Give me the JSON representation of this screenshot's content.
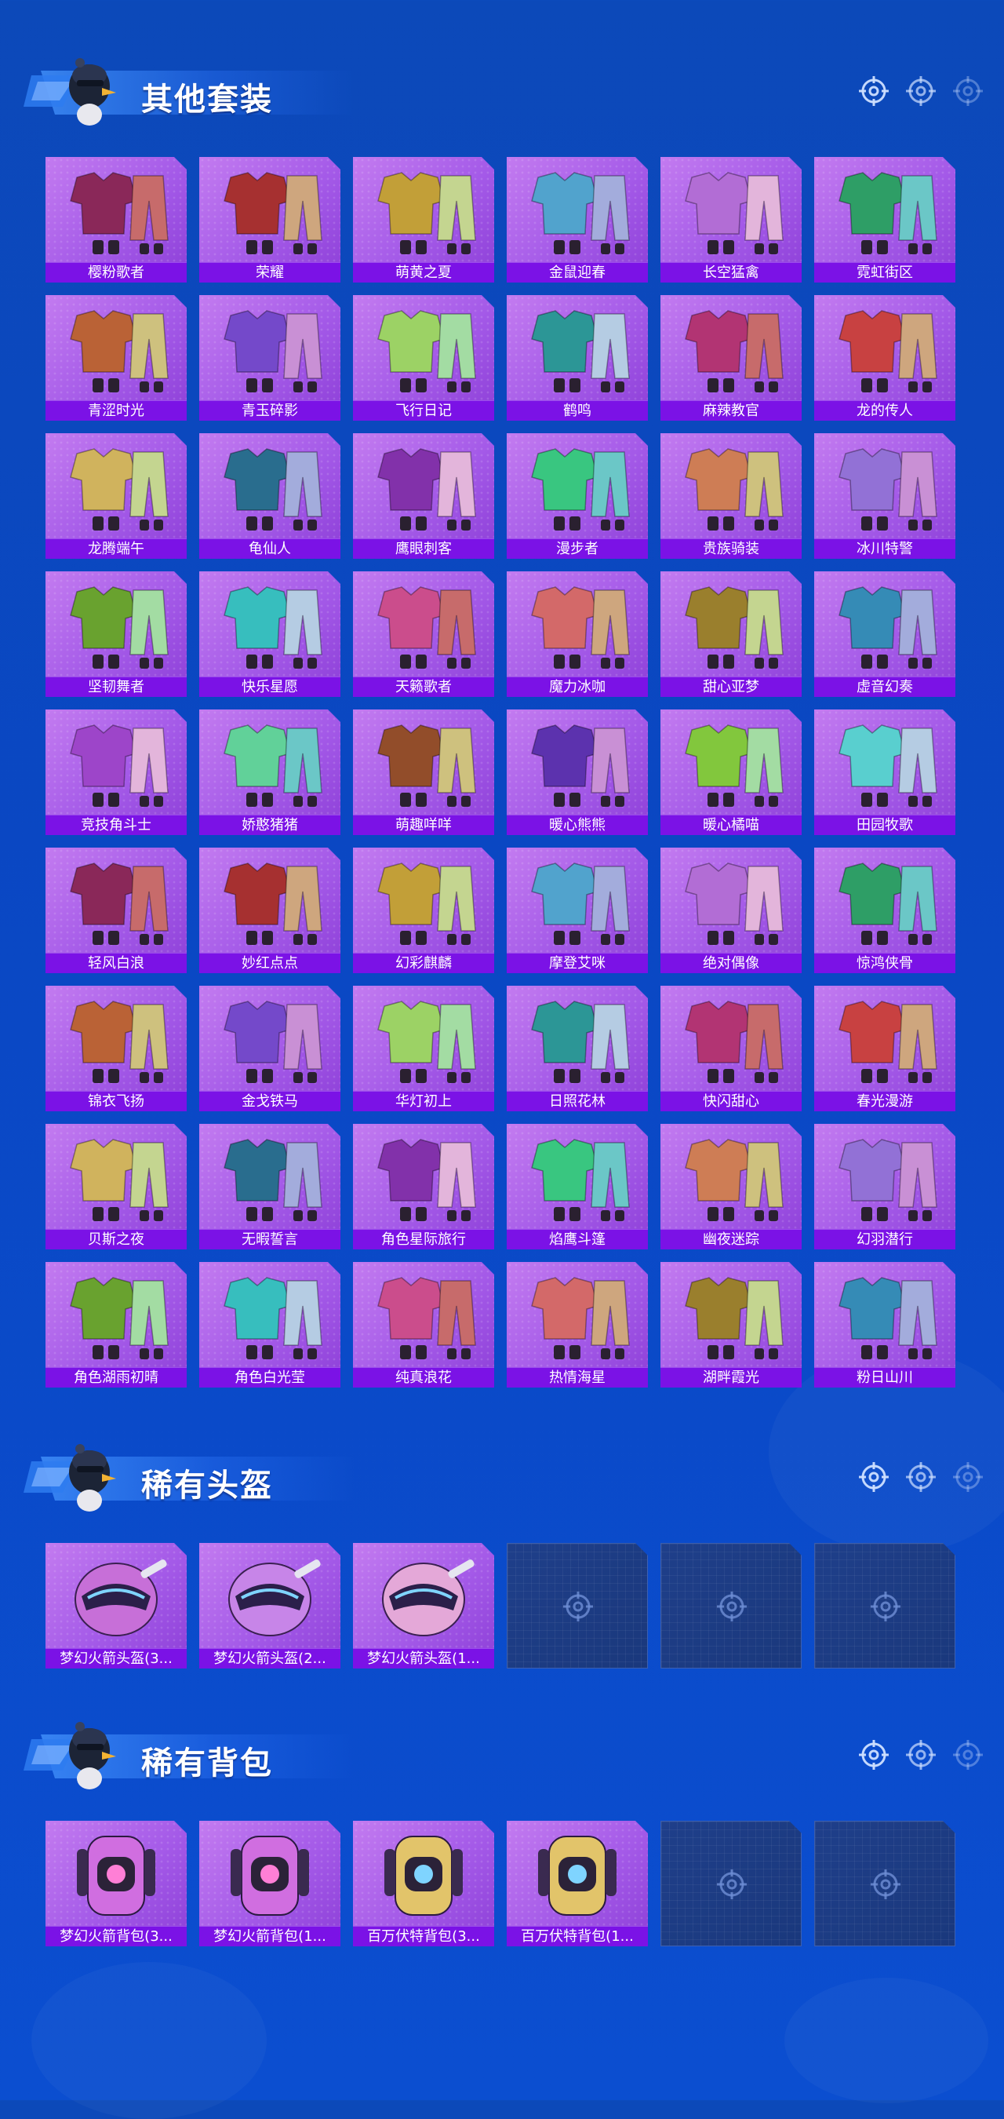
{
  "sections": [
    {
      "title": "其他套装",
      "items": [
        "樱粉歌者",
        "荣耀",
        "萌黄之夏",
        "金鼠迎春",
        "长空猛禽",
        "霓虹街区",
        "青涩时光",
        "青玉碎影",
        "飞行日记",
        "鹤鸣",
        "麻辣教官",
        "龙的传人",
        "龙腾端午",
        "龟仙人",
        "鹰眼刺客",
        "漫步者",
        "贵族骑装",
        "冰川特警",
        "坚韧舞者",
        "快乐星愿",
        "天籁歌者",
        "魔力冰咖",
        "甜心亚梦",
        "虚音幻奏",
        "竞技角斗士",
        "娇憨猪猪",
        "萌趣咩咩",
        "暖心熊熊",
        "暖心橘喵",
        "田园牧歌",
        "轻风白浪",
        "妙红点点",
        "幻彩麒麟",
        "摩登艾咪",
        "绝对偶像",
        "惊鸿侠骨",
        "锦衣飞扬",
        "金戈铁马",
        "华灯初上",
        "日照花林",
        "快闪甜心",
        "春光漫游",
        "贝斯之夜",
        "无暇誓言",
        "角色星际旅行",
        "焰鹰斗篷",
        "幽夜迷踪",
        "幻羽潜行",
        "角色湖雨初晴",
        "角色白光莹",
        "纯真浪花",
        "热情海星",
        "湖畔霞光",
        "粉日山川"
      ]
    },
    {
      "title": "稀有头盔",
      "items": [
        "梦幻火箭头盔(3...",
        "梦幻火箭头盔(2...",
        "梦幻火箭头盔(1..."
      ],
      "empty_slots": 3
    },
    {
      "title": "稀有背包",
      "items": [
        "梦幻火箭背包(3...",
        "梦幻火箭背包(1...",
        "百万伏特背包(3...",
        "百万伏特背包(1..."
      ],
      "empty_slots": 2
    }
  ],
  "icons": {
    "section_mascot": "chicken-mascot-icon",
    "header_decoration": "crosshair-icon",
    "empty_slot": "crosshair-icon"
  },
  "colors": {
    "background": "#0a47c3",
    "card_purple": "#a45ae8",
    "label_purple": "#7b12e6",
    "empty_slot": "#1f3f8a"
  }
}
